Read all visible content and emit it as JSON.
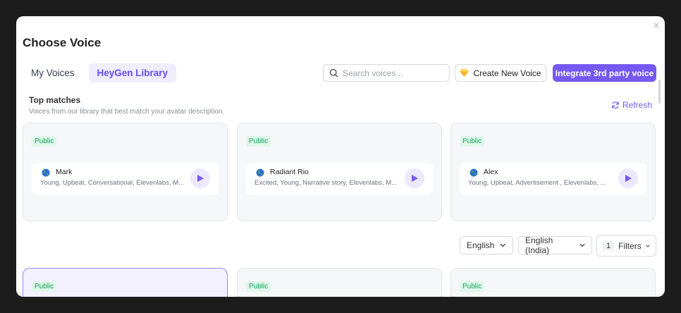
{
  "modal": {
    "title": "Choose Voice",
    "close_label": "×"
  },
  "tabs": [
    {
      "label": "My Voices",
      "active": false
    },
    {
      "label": "HeyGen Library",
      "active": true
    }
  ],
  "search": {
    "placeholder": "Search voices...",
    "value": ""
  },
  "actions": {
    "create_label": "Create New Voice",
    "create_icon": "diamond-icon",
    "integrate_label": "Integrate 3rd party voice"
  },
  "top_matches": {
    "title": "Top matches",
    "subtitle": "Voices from our library that best match your avatar description.",
    "refresh_label": "Refresh",
    "cards": [
      {
        "badge": "Public",
        "name": "Mark",
        "desc": "Young, Upbeat, Conversational, Elevenlabs, M..."
      },
      {
        "badge": "Public",
        "name": "Radiant Rio",
        "desc": "Excited, Young, Narrative story, Elevenlabs, M..."
      },
      {
        "badge": "Public",
        "name": "Alex",
        "desc": "Young, Upbeat, Advertisement , Elevenlabs, ..."
      }
    ]
  },
  "filters": {
    "language": "English",
    "accent": "English (India)",
    "count": "1",
    "label": "Filters"
  },
  "library_cards": [
    {
      "badge": "Public",
      "selected": true
    },
    {
      "badge": "Public",
      "selected": false
    },
    {
      "badge": "Public",
      "selected": false
    }
  ],
  "colors": {
    "accent": "#7559f2",
    "badge_bg": "#dff7ea",
    "badge_text": "#12a35a"
  }
}
